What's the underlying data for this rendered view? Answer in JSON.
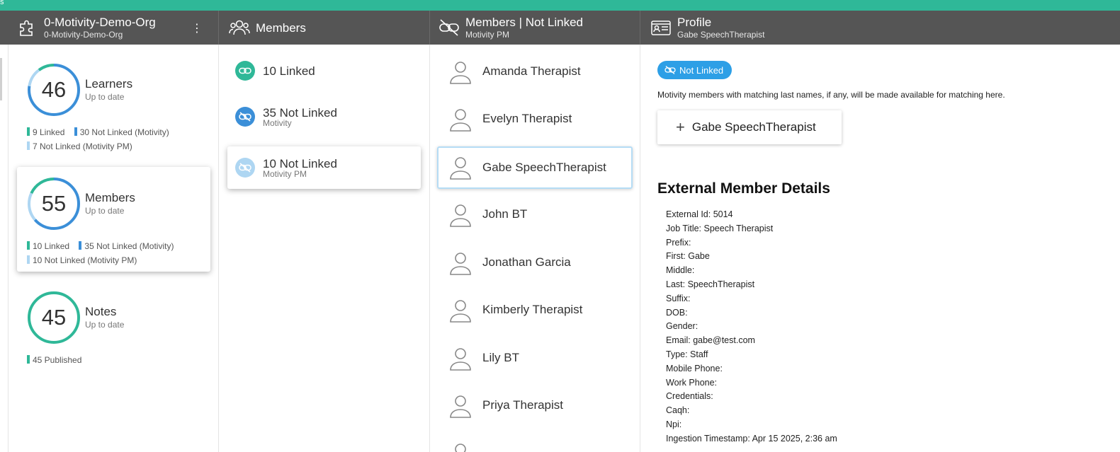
{
  "topbar": {
    "tiny": "s"
  },
  "header": {
    "org": {
      "title": "0-Motivity-Demo-Org",
      "subtitle": "0-Motivity-Demo-Org",
      "menu_glyph": "⋮"
    },
    "members": {
      "title": "Members"
    },
    "not_linked": {
      "title": "Members | Not Linked",
      "subtitle": "Motivity PM"
    },
    "profile": {
      "title": "Profile",
      "subtitle": "Gabe SpeechTherapist"
    }
  },
  "stats": [
    {
      "number": "46",
      "label": "Learners",
      "sub": "Up to date",
      "legend": [
        {
          "text": "9 Linked",
          "color": "#2fb898"
        },
        {
          "text": "30 Not Linked (Motivity)",
          "color": "#3b8fd8"
        },
        {
          "text": "7 Not Linked (Motivity PM)",
          "color": "#aed6f2"
        }
      ]
    },
    {
      "number": "55",
      "label": "Members",
      "sub": "Up to date",
      "legend": [
        {
          "text": "10 Linked",
          "color": "#2fb898"
        },
        {
          "text": "35 Not Linked (Motivity)",
          "color": "#3b8fd8"
        },
        {
          "text": "10 Not Linked (Motivity PM)",
          "color": "#aed6f2"
        }
      ]
    },
    {
      "number": "45",
      "label": "Notes",
      "sub": "Up to date",
      "legend": [
        {
          "text": "45 Published",
          "color": "#2fb898"
        }
      ]
    }
  ],
  "member_groups": [
    {
      "label": "10 Linked",
      "sub": ""
    },
    {
      "label": "35 Not Linked",
      "sub": "Motivity"
    },
    {
      "label": "10 Not Linked",
      "sub": "Motivity PM"
    }
  ],
  "people": [
    "Amanda Therapist",
    "Evelyn Therapist",
    "Gabe SpeechTherapist",
    "John BT",
    "Jonathan Garcia",
    "Kimberly Therapist",
    "Lily BT",
    "Priya Therapist"
  ],
  "profile": {
    "badge": "Not Linked",
    "note": "Motivity members with matching last names, if any, will be made available for matching here.",
    "add_button": "Gabe SpeechTherapist",
    "details_title": "External Member Details",
    "details": [
      "External Id: 5014",
      "Job Title: Speech Therapist",
      "Prefix:",
      "First: Gabe",
      "Middle:",
      "Last: SpeechTherapist",
      "Suffix:",
      "DOB:",
      "Gender:",
      "Email: gabe@test.com",
      "Type: Staff",
      "Mobile Phone:",
      "Work Phone:",
      "Credentials:",
      "Caqh:",
      "Npi:",
      "Ingestion Timestamp: Apr 15 2025, 2:36 am"
    ]
  },
  "colors": {
    "green": "#2fb898",
    "blue": "#3b8fd8",
    "light_blue": "#aed6f2",
    "header": "#555555"
  }
}
